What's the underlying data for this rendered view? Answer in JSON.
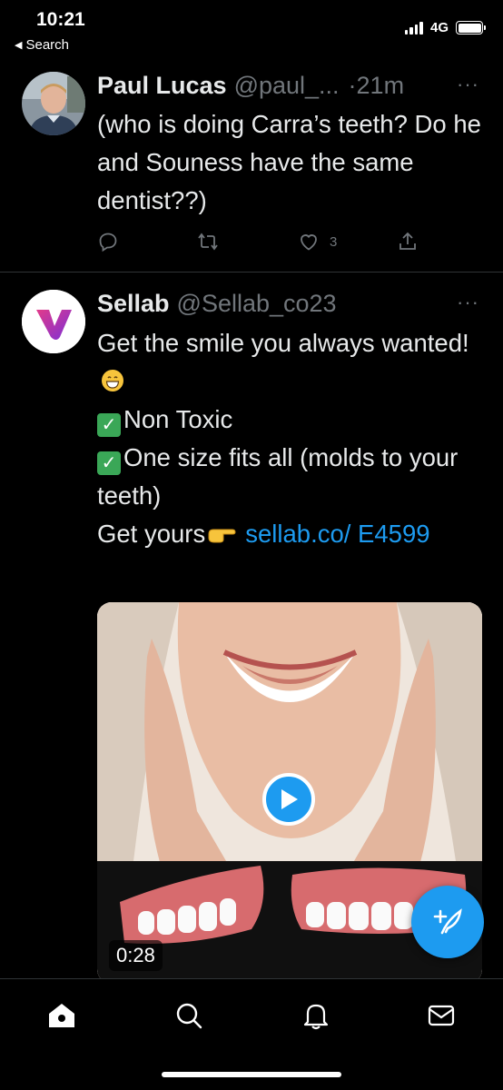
{
  "status_bar": {
    "time": "10:21",
    "back_label": "Search",
    "network": "4G"
  },
  "tweets": [
    {
      "name": "Paul Lucas",
      "handle": "@paul_...",
      "time": "·21m",
      "more": "···",
      "text": "(who is doing Carra’s teeth? Do he and Souness have the same dentist??)",
      "like_count": "3"
    },
    {
      "name": "Sellab",
      "handle": "@Sellab_co23",
      "more": "···",
      "text_line1": "Get the smile you always wanted!",
      "bullet1": "Non Toxic",
      "bullet2": "One size fits all (molds to your teeth)",
      "cta": "Get yours",
      "link": "sellab.co/ E4599",
      "video_duration": "0:28",
      "check_glyph": "✓"
    }
  ],
  "icons": {
    "reply": "reply-icon",
    "retweet": "retweet-icon",
    "like": "heart-icon",
    "share": "share-icon",
    "compose": "compose-tweet-icon",
    "home": "home-icon",
    "search": "search-icon",
    "notifications": "bell-icon",
    "messages": "mail-icon"
  },
  "colors": {
    "background": "#000000",
    "accent": "#1d9bf0",
    "secondary_text": "#71767b",
    "check": "#3aa757"
  }
}
